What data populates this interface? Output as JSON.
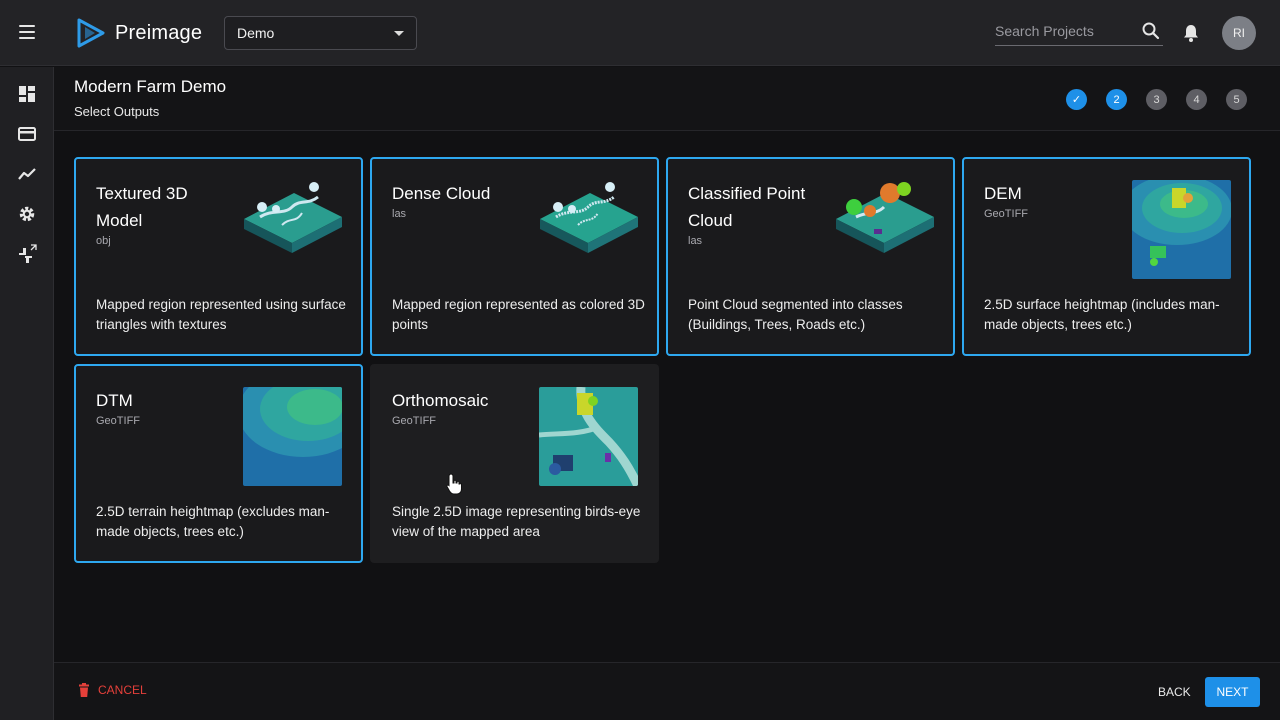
{
  "app": {
    "name": "Preimage"
  },
  "topbar": {
    "project_selected": "Demo",
    "search_placeholder": "Search Projects",
    "avatar_initials": "RI"
  },
  "header": {
    "title": "Modern Farm Demo",
    "subtitle": "Select Outputs"
  },
  "steps": [
    {
      "label": "✓",
      "state": "done"
    },
    {
      "label": "2",
      "state": "active"
    },
    {
      "label": "3",
      "state": "pending"
    },
    {
      "label": "4",
      "state": "pending"
    },
    {
      "label": "5",
      "state": "pending"
    }
  ],
  "outputs": [
    {
      "title": "Textured 3D Model",
      "format": "obj",
      "description": "Mapped region represented using surface triangles with textures",
      "selected": true
    },
    {
      "title": "Dense Cloud",
      "format": "las",
      "description": "Mapped region represented as colored 3D points",
      "selected": true
    },
    {
      "title": "Classified Point Cloud",
      "format": "las",
      "description": "Point Cloud segmented into classes (Buildings, Trees, Roads etc.)",
      "selected": true
    },
    {
      "title": "DEM",
      "format": "GeoTIFF",
      "description": "2.5D surface heightmap (includes man-made objects, trees etc.)",
      "selected": true
    },
    {
      "title": "DTM",
      "format": "GeoTIFF",
      "description": "2.5D terrain heightmap (excludes man-made objects, trees etc.)",
      "selected": true
    },
    {
      "title": "Orthomosaic",
      "format": "GeoTIFF",
      "description": "Single 2.5D image representing birds-eye view of the mapped area",
      "selected": false
    }
  ],
  "footer": {
    "cancel_label": "CANCEL",
    "back_label": "BACK",
    "next_label": "NEXT"
  },
  "colors": {
    "accent": "#1e90e8",
    "card_border": "#2ea8f0",
    "cancel": "#e5403a"
  },
  "icons": {
    "menu": "hamburger-icon",
    "search": "search-icon",
    "notifications": "bell-icon",
    "sidebar": [
      "dashboard-icon",
      "card-icon",
      "trend-icon",
      "gear-icon",
      "feedback-icon"
    ],
    "cancel": "trash-icon"
  }
}
